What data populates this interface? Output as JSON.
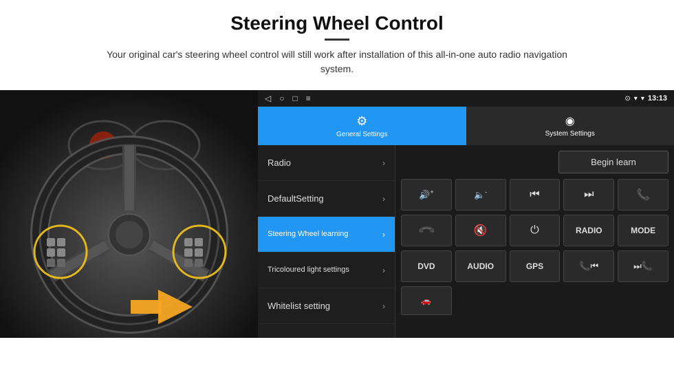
{
  "header": {
    "title": "Steering Wheel Control",
    "subtitle": "Your original car's steering wheel control will still work after installation of this all-in-one auto radio navigation system."
  },
  "status_bar": {
    "back": "◁",
    "home": "○",
    "square": "□",
    "menu": "≡",
    "location": "⊙",
    "wifi": "▾",
    "signal": "▾",
    "time": "13:13"
  },
  "tabs": [
    {
      "label": "General Settings",
      "icon": "⚙",
      "active": true
    },
    {
      "label": "System Settings",
      "icon": "⚙",
      "active": false
    }
  ],
  "menu_items": [
    {
      "text": "Radio",
      "active": false
    },
    {
      "text": "DefaultSetting",
      "active": false
    },
    {
      "text": "Steering Wheel learning",
      "active": true
    },
    {
      "text": "Tricoloured light settings",
      "active": false
    },
    {
      "text": "Whitelist setting",
      "active": false
    }
  ],
  "begin_learn": "Begin learn",
  "control_buttons_row1": [
    {
      "icon": "🔊+",
      "type": "icon"
    },
    {
      "icon": "🔈-",
      "type": "icon"
    },
    {
      "icon": "⏮",
      "type": "icon"
    },
    {
      "icon": "⏭",
      "type": "icon"
    },
    {
      "icon": "📞",
      "type": "icon"
    }
  ],
  "control_buttons_row2": [
    {
      "icon": "📞",
      "type": "icon"
    },
    {
      "icon": "🔇",
      "type": "icon"
    },
    {
      "icon": "⏻",
      "type": "icon"
    },
    {
      "label": "RADIO",
      "type": "text"
    },
    {
      "label": "MODE",
      "type": "text"
    }
  ],
  "control_buttons_row3": [
    {
      "label": "DVD",
      "type": "text"
    },
    {
      "label": "AUDIO",
      "type": "text"
    },
    {
      "label": "GPS",
      "type": "text"
    },
    {
      "icon": "⏮",
      "type": "icon"
    },
    {
      "icon": "⏭",
      "type": "icon"
    }
  ],
  "bottom_row": [
    {
      "icon": "🚗",
      "type": "icon"
    }
  ],
  "colors": {
    "active_blue": "#2196F3",
    "dark_bg": "#1a1a1a",
    "button_bg": "#2a2a2a"
  }
}
